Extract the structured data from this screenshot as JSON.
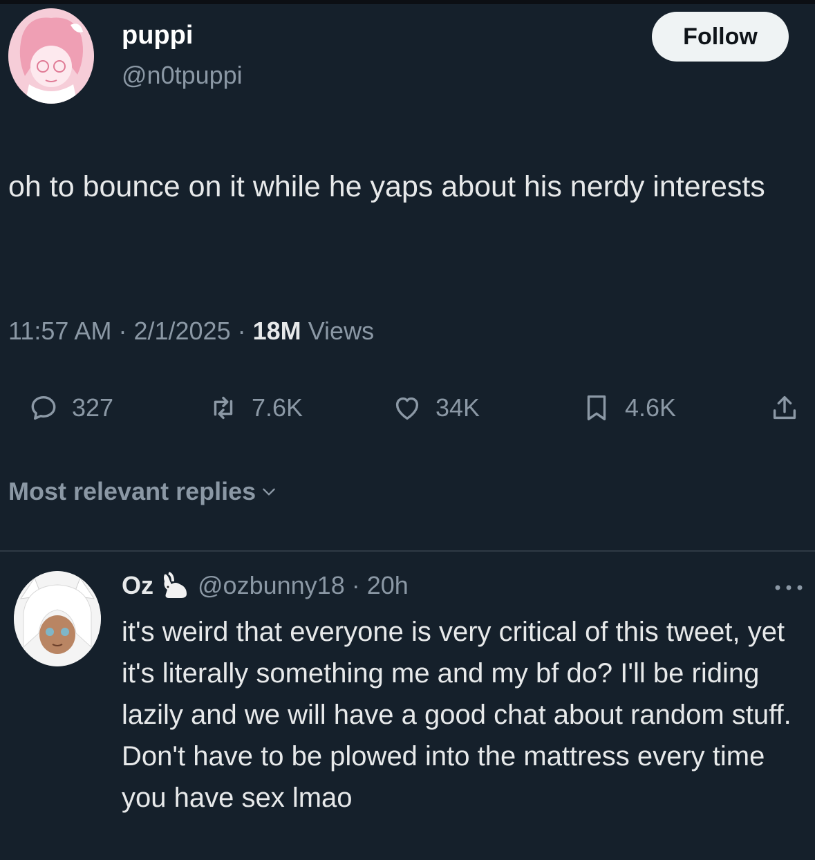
{
  "post": {
    "display_name": "puppi",
    "handle": "@n0tpuppi",
    "follow_label": "Follow",
    "text": "oh to bounce on it while he yaps about his nerdy interests",
    "time": "11:57 AM",
    "date": "2/1/2025",
    "views_count": "18M",
    "views_label": "Views",
    "separator": "·"
  },
  "actions": {
    "replies": "327",
    "reposts": "7.6K",
    "likes": "34K",
    "bookmarks": "4.6K"
  },
  "replies_sort": {
    "label": "Most relevant replies"
  },
  "reply": {
    "display_name": "Oz",
    "handle_time": "@ozbunny18 · 20h",
    "text": "it's weird that everyone is very critical of this tweet, yet it's literally something me and my bf do? I'll be riding lazily and we will have a good chat about random stuff. Don't have to be plowed into the mattress every time you have sex lmao"
  },
  "icons": {
    "reply": "comment-icon",
    "repost": "repost-icon",
    "like": "heart-icon",
    "bookmark": "bookmark-icon",
    "share": "share-icon",
    "badge": "rabbit-icon",
    "more": "more-icon"
  },
  "colors": {
    "background": "#15202b",
    "secondary_text": "#8b98a5",
    "follow_button": "#eff3f4"
  }
}
